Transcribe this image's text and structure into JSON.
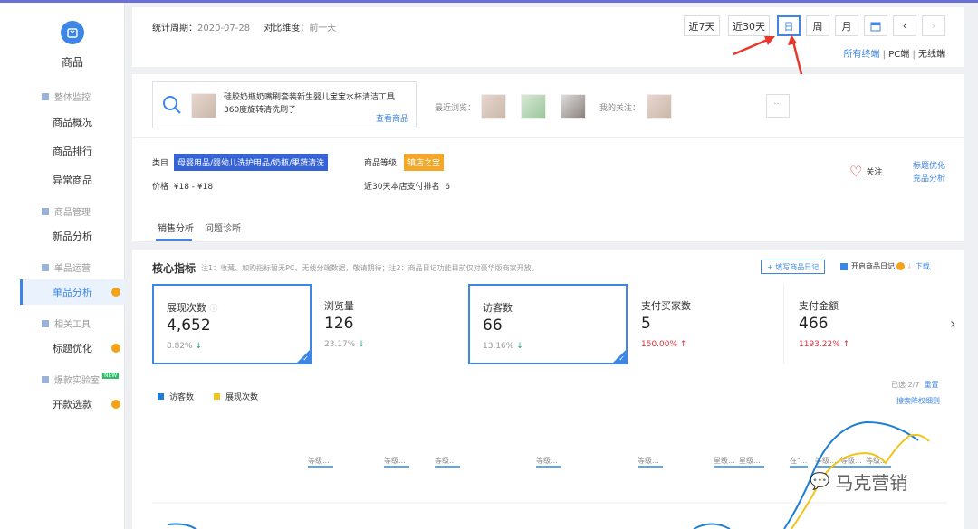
{
  "sidebar": {
    "title": "商品",
    "groups": [
      {
        "label": "整体监控",
        "items": [
          "商品概况",
          "商品排行",
          "异常商品"
        ]
      },
      {
        "label": "商品管理",
        "items": [
          "新品分析"
        ]
      },
      {
        "label": "单品运营",
        "items": [
          "单品分析"
        ]
      },
      {
        "label": "相关工具",
        "items": [
          "标题优化"
        ]
      },
      {
        "label": "爆款实验室",
        "badge": "NEW",
        "items": [
          "开款选款"
        ]
      }
    ]
  },
  "header": {
    "period_label": "统计周期：",
    "period_value": "2020-07-28",
    "compare_label": "对比维度：",
    "compare_value": "前一天",
    "buttons": [
      "近7天",
      "近30天",
      "日",
      "周",
      "月"
    ],
    "active_button": "日",
    "terminals": [
      "所有终端",
      "PC端",
      "无线端"
    ],
    "terminal_sep": "|"
  },
  "product": {
    "title": "硅胶奶瓶奶嘴刷套装新生婴儿宝宝水杯清洁工具360度旋转清洗刷子",
    "view_link": "查看商品",
    "recent_label": "最近浏览：",
    "follow_label": "我的关注：",
    "more": "···",
    "category_label": "类目",
    "category_value": "母婴用品/婴幼儿洗护用品/奶瓶/果蔬清洗",
    "grade_label": "商品等级",
    "grade_value": "镇店之宝",
    "price_label": "价格",
    "price_value": "¥18 - ¥18",
    "rank_label": "近30天本店支付排名",
    "rank_value": "6",
    "follow_button": "关注",
    "links": [
      "标题优化",
      "竞品分析"
    ]
  },
  "tabs": [
    "销售分析",
    "问题诊断"
  ],
  "core": {
    "title": "核心指标",
    "note": "注1：收藏、加购指标暂无PC、无线分端数据，敬请期待；注2：商品日记功能目前仅对豪华版商家开放。",
    "write_diary": "+ 填写商品日记",
    "diary_toggle": "开启商品日记",
    "download": "下载"
  },
  "metrics": [
    {
      "name": "展现次数",
      "value": "4,652",
      "pct": "8.82%",
      "dir": "down",
      "selected": true
    },
    {
      "name": "浏览量",
      "value": "126",
      "pct": "23.17%",
      "dir": "down",
      "selected": false
    },
    {
      "name": "访客数",
      "value": "66",
      "pct": "13.16%",
      "dir": "down",
      "selected": true
    },
    {
      "name": "支付买家数",
      "value": "5",
      "pct": "150.00%",
      "dir": "up",
      "selected": false
    },
    {
      "name": "支付金额",
      "value": "466",
      "pct": "1193.22%",
      "dir": "up",
      "selected": false
    }
  ],
  "chart": {
    "legend": [
      {
        "name": "访客数",
        "color": "#1f7fd6"
      },
      {
        "name": "展现次数",
        "color": "#f0c419"
      }
    ],
    "selected": "已选 2/7",
    "reset": "重置",
    "rule_link": "搜索降权细则",
    "event_labels": [
      "等级...",
      "等级...",
      "等级...",
      "等级...",
      "等级...",
      "星级...",
      "星级...",
      "在\"...",
      "等级...",
      "等级...",
      "等级..."
    ]
  },
  "watermark": "马克营销",
  "colors": {
    "accent": "#3d86e6",
    "up": "#e0303b",
    "down": "#1fa86a",
    "orange": "#f2a31b"
  }
}
